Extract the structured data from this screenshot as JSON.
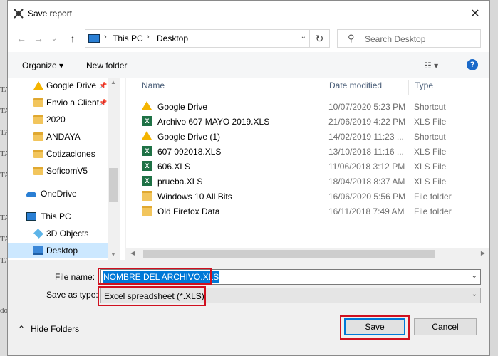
{
  "window": {
    "title": "Save report",
    "close_glyph": "✕"
  },
  "background_text": [
    "TA",
    "TA",
    "TA",
    "TA",
    "TA",
    "TA",
    "TA",
    "TA",
    "do"
  ],
  "nav": {
    "back_glyph": "←",
    "forward_glyph": "→",
    "dropdown_glyph": "⌄",
    "up_glyph": "↑"
  },
  "address": {
    "crumbs": [
      "This PC",
      "Desktop"
    ],
    "separator": "›",
    "dropdown_glyph": "⌄",
    "refresh_glyph": "↻"
  },
  "search": {
    "placeholder": "Search Desktop",
    "icon_glyph": "⚲"
  },
  "toolbar": {
    "organize_label": "Organize ▾",
    "new_folder_label": "New folder",
    "view_glyph": "☷ ▾",
    "help_glyph": "?"
  },
  "sidebar": {
    "items": [
      {
        "label": "Google Drive",
        "icon": "google-drive-icon",
        "pinned": true
      },
      {
        "label": "Envio a Client",
        "icon": "folder-icon",
        "pinned": true
      },
      {
        "label": "2020",
        "icon": "folder-icon",
        "pinned": false
      },
      {
        "label": "ANDAYA",
        "icon": "folder-icon",
        "pinned": false
      },
      {
        "label": "Cotizaciones",
        "icon": "folder-icon",
        "pinned": false
      },
      {
        "label": "SoficomV5",
        "icon": "folder-icon",
        "pinned": false
      },
      {
        "label": "OneDrive",
        "icon": "onedrive-icon",
        "pinned": false
      },
      {
        "label": "This PC",
        "icon": "this-pc-icon",
        "pinned": false
      },
      {
        "label": "3D Objects",
        "icon": "3d-objects-icon",
        "pinned": false
      },
      {
        "label": "Desktop",
        "icon": "desktop-icon",
        "pinned": false,
        "selected": true
      }
    ],
    "pin_glyph": "📌"
  },
  "columns": {
    "name": "Name",
    "date_modified": "Date modified",
    "type": "Type"
  },
  "files": [
    {
      "name": "Google Drive",
      "date": "10/07/2020 5:23 PM",
      "type": "Shortcut",
      "icon": "google-drive-icon"
    },
    {
      "name": "Archivo 607 MAYO 2019.XLS",
      "date": "21/06/2019 4:22 PM",
      "type": "XLS File",
      "icon": "excel-icon"
    },
    {
      "name": "Google Drive (1)",
      "date": "14/02/2019 11:23 ...",
      "type": "Shortcut",
      "icon": "google-drive-icon"
    },
    {
      "name": "607 092018.XLS",
      "date": "13/10/2018 11:16 ...",
      "type": "XLS File",
      "icon": "excel-icon"
    },
    {
      "name": "606.XLS",
      "date": "11/06/2018 3:12 PM",
      "type": "XLS File",
      "icon": "excel-icon"
    },
    {
      "name": "prueba.XLS",
      "date": "18/04/2018 8:37 AM",
      "type": "XLS File",
      "icon": "excel-icon"
    },
    {
      "name": "Windows 10 All Bits",
      "date": "16/06/2020 5:56 PM",
      "type": "File folder",
      "icon": "folder-icon"
    },
    {
      "name": "Old Firefox Data",
      "date": "16/11/2018 7:49 AM",
      "type": "File folder",
      "icon": "folder-icon"
    }
  ],
  "form": {
    "file_name_label": "File name:",
    "file_name_value": "NOMBRE DEL ARCHIVO.XLS",
    "save_as_type_label": "Save as type:",
    "save_as_type_value": "Excel spreadsheet (*.XLS)",
    "dropdown_glyph": "⌄"
  },
  "footer": {
    "hide_folders_label": "Hide Folders",
    "hide_folders_glyph": "⌃",
    "save_label": "Save",
    "cancel_label": "Cancel"
  },
  "colors": {
    "selection": "#0078d7",
    "highlight_box": "#d0101f",
    "sidebar_selected": "#cce8ff"
  }
}
